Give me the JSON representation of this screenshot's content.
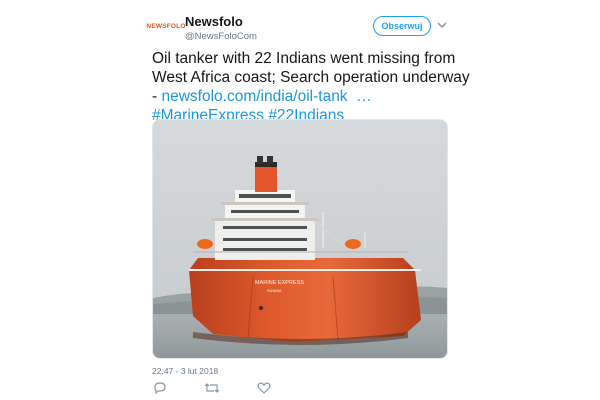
{
  "colors": {
    "accent": "#1da1f2",
    "link": "#1b95e0",
    "brand": "#e0541f",
    "muted": "#657786"
  },
  "author": {
    "avatar_text": "NEWSFOLO",
    "name": "Newsfolo",
    "handle": "@NewsFoloCom",
    "follow_label": "Obserwuj",
    "more_icon": "chevron-down-icon"
  },
  "tweet": {
    "line1": "Oil tanker with 22 Indians went missing from",
    "line2": "West Africa coast; Search operation underway",
    "line3_prefix": "- ",
    "link": "newsfolo.com/india/oil-tank",
    "link_ellipsis": "  …",
    "hashtag1": "#MarineExpress",
    "hashtag2": "#22Indians"
  },
  "photo": {
    "ship_name": "MARINE EXPRESS",
    "port": "PANAMA"
  },
  "timestamp": "22:47 - 3 lut 2018",
  "actions": [
    "reply-icon",
    "retweet-icon",
    "like-icon"
  ]
}
